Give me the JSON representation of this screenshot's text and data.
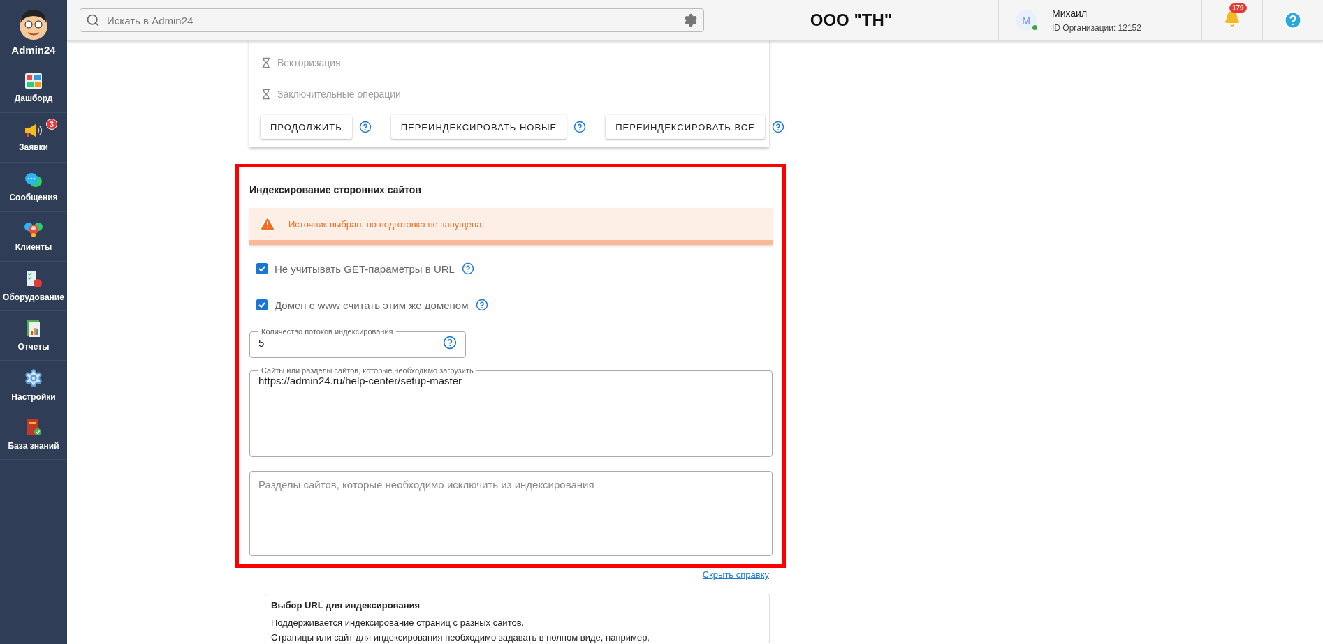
{
  "sidebar": {
    "brand": "Admin24",
    "items": [
      {
        "label": "Дашборд",
        "kind": "dashboard"
      },
      {
        "label": "Заявки",
        "kind": "requests",
        "badge": "3"
      },
      {
        "label": "Сообщения",
        "kind": "messages"
      },
      {
        "label": "Клиенты",
        "kind": "clients"
      },
      {
        "label": "Оборудование",
        "kind": "equipment"
      },
      {
        "label": "Отчеты",
        "kind": "reports"
      },
      {
        "label": "Настройки",
        "kind": "settings"
      },
      {
        "label": "База знаний",
        "kind": "knowledge"
      }
    ]
  },
  "header": {
    "search": {
      "placeholder": "Искать в Admin24"
    },
    "org_name": "ООО \"ТН\"",
    "user": {
      "avatar": "М",
      "online": true,
      "name": "Михаил",
      "org_id": "ID Организации: 12152"
    },
    "notifications": "179"
  },
  "steps": [
    {
      "label": "Векторизация"
    },
    {
      "label": "Заключительные операции"
    }
  ],
  "actions": [
    {
      "label": "ПРОДОЛЖИТЬ"
    },
    {
      "label": "ПЕРЕИНДЕКСИРОВАТЬ НОВЫЕ"
    },
    {
      "label": "ПЕРЕИНДЕКСИРОВАТЬ ВСЕ"
    }
  ],
  "section": {
    "title": "Индексирование сторонних сайтов",
    "alert": "Источник выбран, но подготовка не запущена.",
    "checkboxes": [
      {
        "label": "Не учитывать GET-параметры в URL",
        "checked": true
      },
      {
        "label": "Домен с www считать этим же доменом",
        "checked": true
      }
    ],
    "threads_field": {
      "label": "Количество потоков индексирования",
      "value": "5"
    },
    "sites_field": {
      "label": "Сайты или разделы сайтов, которые необходимо загрузить",
      "value": "https://admin24.ru/help-center/setup-master"
    },
    "exclude_field": {
      "placeholder": "Разделы сайтов, которые необходимо исключить из индексирования"
    }
  },
  "hide_help_link": "Скрыть справку",
  "help": {
    "title": "Выбор URL для индексирования",
    "lines": [
      "Поддерживается индексирование страниц с разных сайтов.",
      "Страницы или сайт для индексирования необходимо задавать в полном виде, например,"
    ]
  }
}
